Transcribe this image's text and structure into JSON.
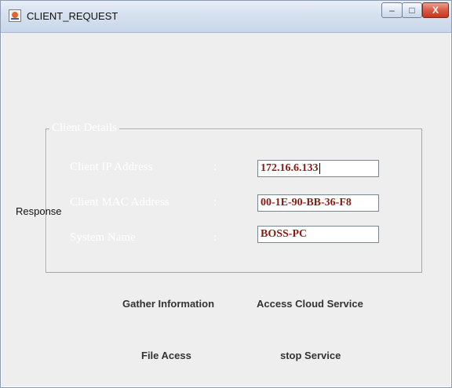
{
  "window": {
    "title": "CLIENT_REQUEST",
    "minimize_glyph": "–",
    "maximize_glyph": "□",
    "close_glyph": "X"
  },
  "client_details": {
    "legend": "Client Details",
    "rows": [
      {
        "label": "Client IP Address",
        "colon": ":",
        "value": "172.16.6.133"
      },
      {
        "label": "Client MAC Address",
        "colon": ":",
        "value": "00-1E-90-BB-36-F8"
      },
      {
        "label": "System Name",
        "colon": ":",
        "value": "BOSS-PC"
      }
    ]
  },
  "response_label": "Response",
  "buttons": {
    "gather_information": "Gather Information",
    "access_cloud_service": "Access Cloud Service",
    "file_access": "File Acess",
    "stop_service": "stop Service"
  },
  "colors": {
    "field_text": "#8b1a14",
    "background": "#eeeeee"
  }
}
